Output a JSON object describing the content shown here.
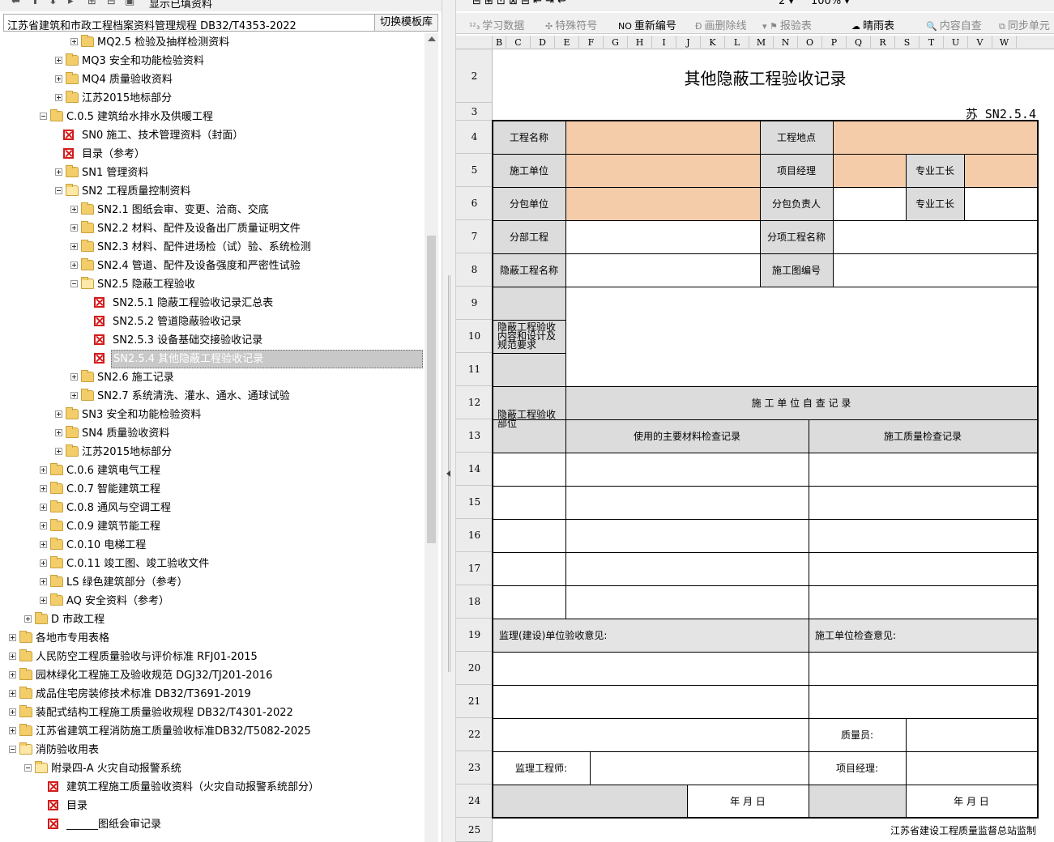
{
  "left_panel": {
    "toolbar_label": "显示已填资料",
    "path": "江苏省建筑和市政工程档案资料管理规程 DB32/T4353-2022",
    "switch_button": "切换模板库",
    "tree": [
      {
        "label": "MQ2.5 检验及抽样检测资料",
        "level": 4,
        "type": "folder",
        "state": "plus"
      },
      {
        "label": "MQ3 安全和功能检验资料",
        "level": 3,
        "type": "folder",
        "state": "plus"
      },
      {
        "label": "MQ4 质量验收资料",
        "level": 3,
        "type": "folder",
        "state": "plus"
      },
      {
        "label": "江苏2015地标部分",
        "level": 3,
        "type": "folder",
        "state": "plus"
      },
      {
        "label": "C.0.5 建筑给水排水及供暖工程",
        "level": 2,
        "type": "folder",
        "state": "minus"
      },
      {
        "label": "SN0 施工、技术管理资料（封面）",
        "level": 3,
        "type": "doc"
      },
      {
        "label": "目录（参考）",
        "level": 3,
        "type": "doc"
      },
      {
        "label": "SN1 管理资料",
        "level": 3,
        "type": "folder",
        "state": "plus"
      },
      {
        "label": "SN2 工程质量控制资料",
        "level": 3,
        "type": "folder-open",
        "state": "minus"
      },
      {
        "label": "SN2.1 图纸会审、变更、洽商、交底",
        "level": 4,
        "type": "folder",
        "state": "plus"
      },
      {
        "label": "SN2.2 材料、配件及设备出厂质量证明文件",
        "level": 4,
        "type": "folder",
        "state": "plus"
      },
      {
        "label": "SN2.3 材料、配件进场检（试）验、系统检测",
        "level": 4,
        "type": "folder",
        "state": "plus"
      },
      {
        "label": "SN2.4 管道、配件及设备强度和严密性试验",
        "level": 4,
        "type": "folder",
        "state": "plus"
      },
      {
        "label": "SN2.5 隐蔽工程验收",
        "level": 4,
        "type": "folder-open",
        "state": "minus"
      },
      {
        "label": "SN2.5.1 隐蔽工程验收记录汇总表",
        "level": 5,
        "type": "doc"
      },
      {
        "label": "SN2.5.2 管道隐蔽验收记录",
        "level": 5,
        "type": "doc"
      },
      {
        "label": "SN2.5.3 设备基础交接验收记录",
        "level": 5,
        "type": "doc"
      },
      {
        "label": "SN2.5.4 其他隐蔽工程验收记录",
        "level": 5,
        "type": "doc",
        "selected": true
      },
      {
        "label": "SN2.6 施工记录",
        "level": 4,
        "type": "folder",
        "state": "plus"
      },
      {
        "label": "SN2.7 系统清洗、灌水、通水、通球试验",
        "level": 4,
        "type": "folder",
        "state": "plus"
      },
      {
        "label": "SN3 安全和功能检验资料",
        "level": 3,
        "type": "folder",
        "state": "plus"
      },
      {
        "label": "SN4 质量验收资料",
        "level": 3,
        "type": "folder",
        "state": "plus"
      },
      {
        "label": "江苏2015地标部分",
        "level": 3,
        "type": "folder",
        "state": "plus"
      },
      {
        "label": "C.0.6 建筑电气工程",
        "level": 2,
        "type": "folder",
        "state": "plus"
      },
      {
        "label": "C.0.7 智能建筑工程",
        "level": 2,
        "type": "folder",
        "state": "plus"
      },
      {
        "label": "C.0.8 通风与空调工程",
        "level": 2,
        "type": "folder",
        "state": "plus"
      },
      {
        "label": "C.0.9 建筑节能工程",
        "level": 2,
        "type": "folder",
        "state": "plus"
      },
      {
        "label": "C.0.10 电梯工程",
        "level": 2,
        "type": "folder",
        "state": "plus"
      },
      {
        "label": "C.0.11 竣工图、竣工验收文件",
        "level": 2,
        "type": "folder",
        "state": "plus"
      },
      {
        "label": "LS 绿色建筑部分（参考）",
        "level": 2,
        "type": "folder",
        "state": "plus"
      },
      {
        "label": "AQ 安全资料（参考）",
        "level": 2,
        "type": "folder",
        "state": "plus"
      },
      {
        "label": "D 市政工程",
        "level": 1,
        "type": "folder",
        "state": "plus"
      },
      {
        "label": "各地市专用表格",
        "level": 0,
        "type": "folder",
        "state": "plus"
      },
      {
        "label": "人民防空工程质量验收与评价标准 RFJ01-2015",
        "level": 0,
        "type": "folder",
        "state": "plus"
      },
      {
        "label": "园林绿化工程施工及验收规范 DGJ32/TJ201-2016",
        "level": 0,
        "type": "folder",
        "state": "plus"
      },
      {
        "label": "成品住宅房装修技术标准 DB32/T3691-2019",
        "level": 0,
        "type": "folder",
        "state": "plus"
      },
      {
        "label": "装配式结构工程施工质量验收规程 DB32/T4301-2022",
        "level": 0,
        "type": "folder",
        "state": "plus"
      },
      {
        "label": "江苏省建筑工程消防施工质量验收标准DB32/T5082-2025",
        "level": 0,
        "type": "folder",
        "state": "plus"
      },
      {
        "label": "消防验收用表",
        "level": 0,
        "type": "folder-open",
        "state": "minus"
      },
      {
        "label": "附录四-A 火灾自动报警系统",
        "level": 1,
        "type": "folder-open",
        "state": "minus"
      },
      {
        "label": "建筑工程施工质量验收资料（火灾自动报警系统部分）",
        "level": 2,
        "type": "doc"
      },
      {
        "label": "目录",
        "level": 2,
        "type": "doc"
      },
      {
        "label": "______图纸会审记录",
        "level": 2,
        "type": "doc"
      }
    ]
  },
  "right_panel": {
    "toolbar": {
      "zoom": "100%",
      "buttons": [
        {
          "label": "学习数据",
          "glyph": "¹²₃",
          "enabled": false
        },
        {
          "label": "特殊符号",
          "glyph": "✣",
          "enabled": false
        },
        {
          "label": "重新编号",
          "glyph": "NO",
          "enabled": true
        },
        {
          "label": "画删除线",
          "glyph": "Đ",
          "enabled": false
        },
        {
          "label": "报验表",
          "glyph": "▾ ⚑",
          "enabled": false
        },
        {
          "label": "晴雨表",
          "glyph": "☁",
          "enabled": true
        },
        {
          "label": "内容自查",
          "glyph": "🔍",
          "enabled": false
        },
        {
          "label": "同步单元",
          "glyph": "⧉",
          "enabled": false
        }
      ]
    },
    "column_headers": [
      "B",
      "C",
      "D",
      "E",
      "F",
      "G",
      "H",
      "I",
      "J",
      "K",
      "L",
      "M",
      "N",
      "O",
      "P",
      "Q",
      "R",
      "S",
      "T",
      "U",
      "V",
      "W"
    ],
    "row_numbers": [
      "2",
      "3",
      "4",
      "5",
      "6",
      "7",
      "8",
      "9",
      "10",
      "11",
      "12",
      "13",
      "14",
      "15",
      "16",
      "17",
      "18",
      "19",
      "20",
      "21",
      "22",
      "23",
      "24",
      "25"
    ],
    "form": {
      "title": "其他隐蔽工程验收记录",
      "code": "苏 SN2.5.4",
      "project_name": "工程名称",
      "project_location": "工程地点",
      "construction_unit": "施工单位",
      "project_manager": "项目经理",
      "foreman": "专业工长",
      "subcontract_unit": "分包单位",
      "subcontract_lead": "分包负责人",
      "foreman2": "专业工长",
      "division": "分部工程",
      "subitem": "分项工程名称",
      "hidden_name": "隐蔽工程名称",
      "drawing_no": "施工图编号",
      "content_req": "隐蔽工程验收内容和设计及规范要求",
      "hidden_part": "隐蔽工程验收部位",
      "self_check": "施 工 单 位 自 查 记 录",
      "material_check": "使用的主要材料检查记录",
      "quality_check": "施工质量检查记录",
      "supervision_opinion": "监理(建设)单位验收意见:",
      "construction_opinion": "施工单位检查意见:",
      "quality_officer": "质量员:",
      "supervising_engineer": "监理工程师:",
      "project_manager2": "项目经理:",
      "date1": "年  月  日",
      "date2": "年  月  日",
      "footer": "江苏省建设工程质量监督总站监制"
    }
  }
}
